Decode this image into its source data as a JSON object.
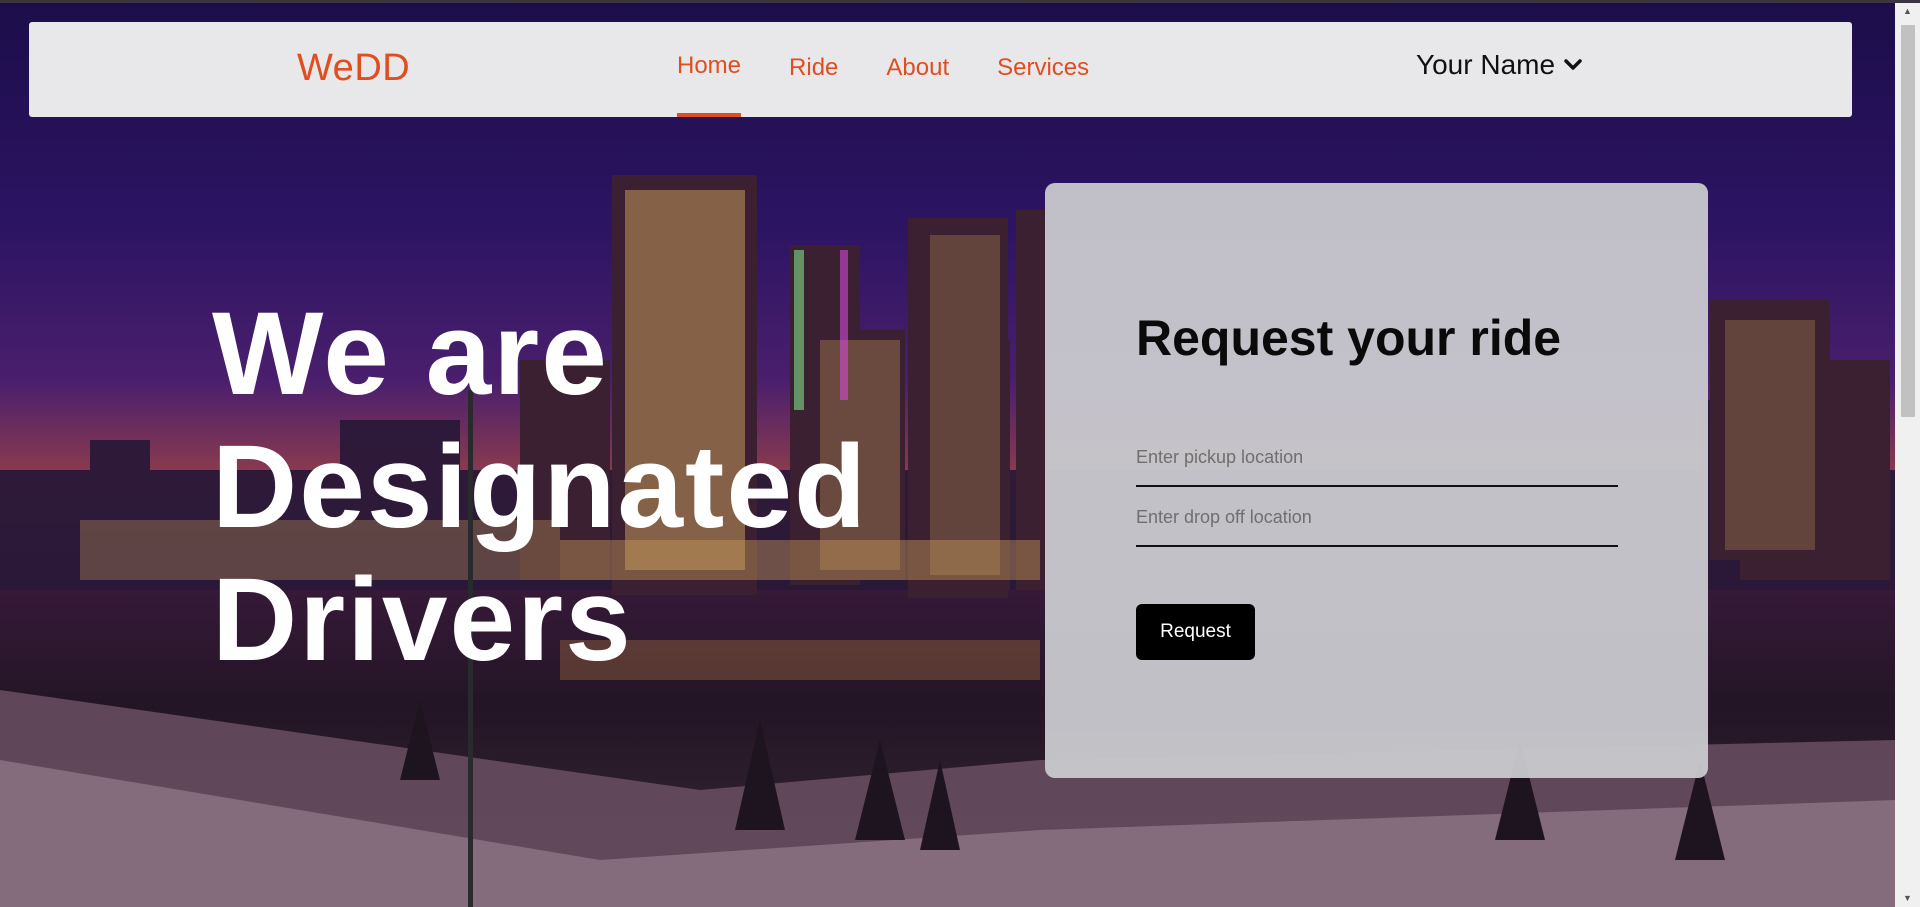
{
  "navbar": {
    "brand": "WeDD",
    "links": [
      {
        "label": "Home",
        "active": true
      },
      {
        "label": "Ride",
        "active": false
      },
      {
        "label": "About",
        "active": false
      },
      {
        "label": "Services",
        "active": false
      }
    ],
    "user_name": "Your Name",
    "user_icon": "chevron-down-icon"
  },
  "hero": {
    "lines": [
      "We are",
      "Designated",
      "Drivers"
    ]
  },
  "request_card": {
    "title": "Request your ride",
    "pickup_placeholder": "Enter pickup location",
    "pickup_value": "",
    "dropoff_placeholder": "Enter drop off location",
    "dropoff_value": "",
    "button_label": "Request"
  },
  "colors": {
    "accent": "#e04e1f",
    "navbar_bg": "#e8e8eb",
    "button_bg": "#000000"
  }
}
